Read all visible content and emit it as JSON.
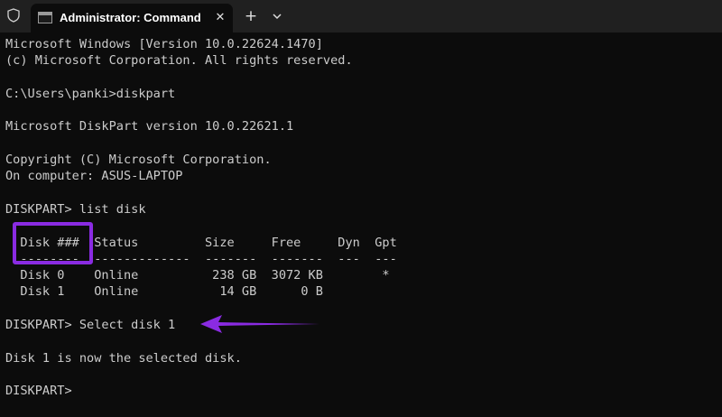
{
  "window": {
    "tab_title": "Administrator: Command Pro",
    "close_glyph": "✕",
    "new_tab_glyph": "+",
    "shield_icon": "shield-icon",
    "dropdown_icon": "chevron-down-icon"
  },
  "console": {
    "lines": [
      "Microsoft Windows [Version 10.0.22624.1470]",
      "(c) Microsoft Corporation. All rights reserved.",
      "",
      "C:\\Users\\panki>diskpart",
      "",
      "Microsoft DiskPart version 10.0.22621.1",
      "",
      "Copyright (C) Microsoft Corporation.",
      "On computer: ASUS-LAPTOP",
      "",
      "DISKPART> list disk",
      "",
      "  Disk ###  Status         Size     Free     Dyn  Gpt",
      "  --------  -------------  -------  -------  ---  ---",
      "  Disk 0    Online          238 GB  3072 KB        *",
      "  Disk 1    Online           14 GB      0 B",
      "",
      "DISKPART> Select disk 1",
      "",
      "Disk 1 is now the selected disk.",
      "",
      "DISKPART> "
    ]
  },
  "colors": {
    "annotation": "#8a2be2",
    "console_text": "#cccccc",
    "console_bg": "#0c0c0c",
    "titlebar_bg": "#202020"
  }
}
